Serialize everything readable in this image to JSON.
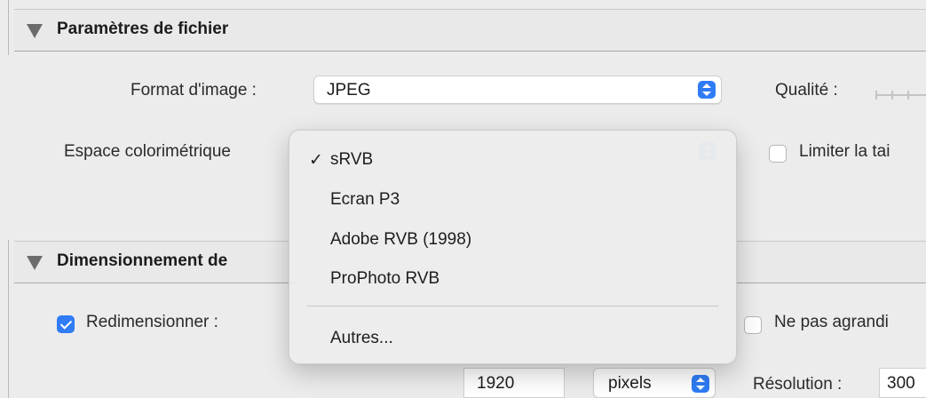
{
  "file_settings": {
    "title": "Paramètres de fichier",
    "format_label": "Format d'image :",
    "format_value": "JPEG",
    "quality_label": "Qualité :",
    "colorspace_label": "Espace colorimétrique",
    "limit_size_label": "Limiter la tai",
    "limit_size_checked": false
  },
  "colorspace_menu": {
    "items": [
      {
        "label": "sRVB",
        "checked": true
      },
      {
        "label": "Ecran P3",
        "checked": false
      },
      {
        "label": "Adobe RVB (1998)",
        "checked": false
      },
      {
        "label": "ProPhoto RVB",
        "checked": false
      }
    ],
    "other": "Autres...",
    "check_glyph": "✓"
  },
  "sizing": {
    "title": "Dimensionnement de",
    "resize_label": "Redimensionner :",
    "resize_checked": true,
    "no_enlarge_label": "Ne pas agrandi",
    "no_enlarge_checked": false,
    "dimension_value": "1920",
    "unit_value": "pixels",
    "resolution_label": "Résolution :",
    "resolution_value": "300"
  },
  "colors": {
    "accent": "#2f7cf6",
    "background": "#ececec"
  }
}
